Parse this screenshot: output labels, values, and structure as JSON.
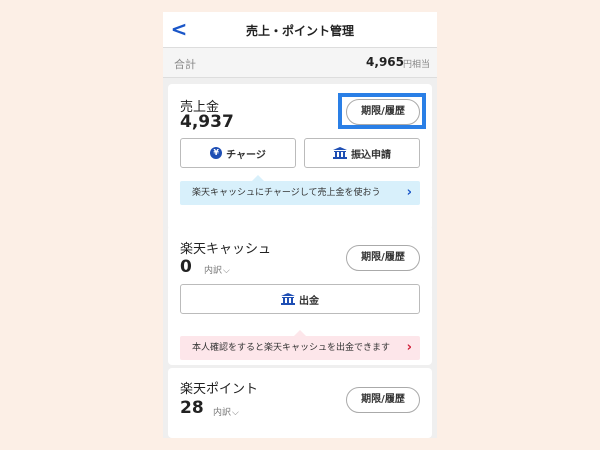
{
  "header": {
    "back_glyph": "<",
    "title": "売上・ポイント管理"
  },
  "total": {
    "label": "合計",
    "value": "4,965",
    "unit": "円相当"
  },
  "sales": {
    "title": "売上金",
    "amount": "4,937",
    "history_button": "期限/履歴",
    "charge_button": "チャージ",
    "transfer_button": "振込申請",
    "banner": "楽天キャッシュにチャージして売上金を使おう"
  },
  "cash": {
    "title": "楽天キャッシュ",
    "amount": "0",
    "breakdown": "内訳",
    "history_button": "期限/履歴",
    "withdraw_button": "出金",
    "banner": "本人確認をすると楽天キャッシュを出金できます"
  },
  "points": {
    "title": "楽天ポイント",
    "amount": "28",
    "breakdown": "内訳",
    "history_button": "期限/履歴"
  },
  "colors": {
    "accent": "#1a56c8",
    "highlight": "#2a7fe6",
    "banner_blue": "#d8f0fb",
    "banner_pink": "#fde6ea",
    "chevron_pink": "#d0203a"
  }
}
